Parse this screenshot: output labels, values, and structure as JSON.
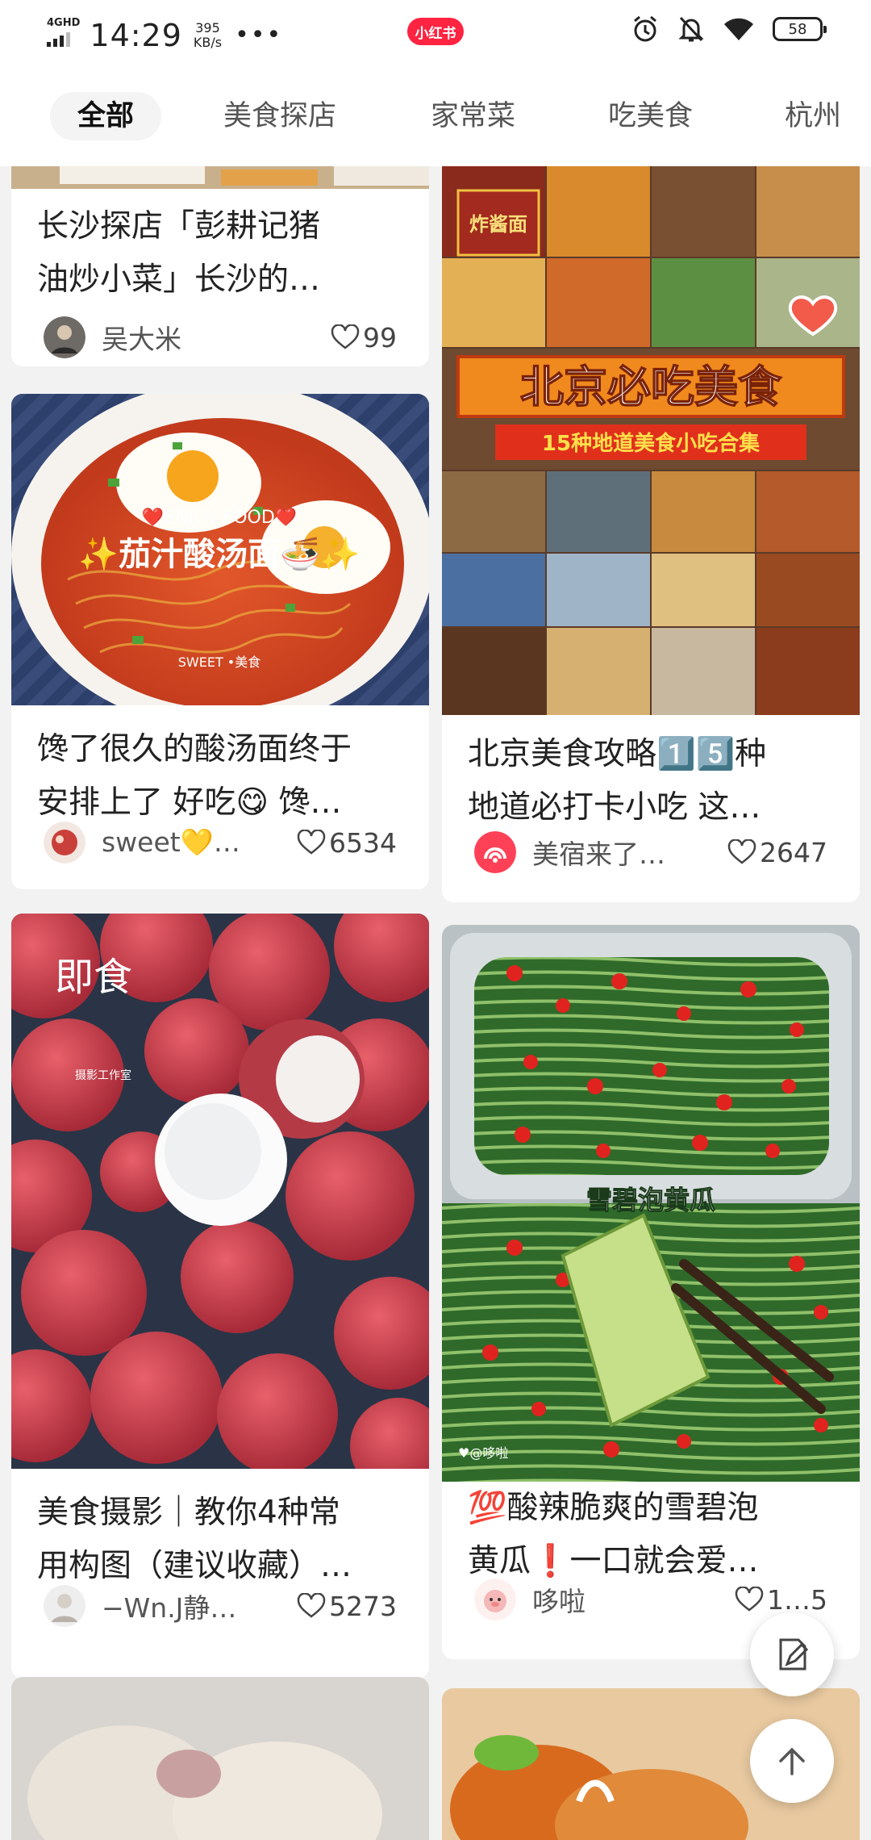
{
  "status_bar": {
    "network": "4GHD",
    "time": "14:29",
    "speed_value": "395",
    "speed_unit": "KB/s",
    "more": "•••",
    "brand": "小红书",
    "battery": "58"
  },
  "tabs": [
    {
      "label": "全部",
      "active": true
    },
    {
      "label": "美食探店"
    },
    {
      "label": "家常菜"
    },
    {
      "label": "吃美食"
    },
    {
      "label": "杭州"
    }
  ],
  "feed": {
    "left": [
      {
        "title_1": "长沙探店「彭耕记猪",
        "title_2": "油炒小菜」长沙的…",
        "author": "吴大米",
        "likes": "99"
      },
      {
        "title_1": "馋了很久的酸汤面终于",
        "title_2": "安排上了 好吃😋 馋…",
        "author": "sweet💛…",
        "likes": "6534",
        "image_text": {
          "top": "❤️ENJOY FOOD❤️",
          "main": "✨茄汁酸汤面🍜✨",
          "bottom": "SWEET •美食"
        }
      },
      {
        "title_1": "美食摄影｜教你4种常",
        "title_2": "用构图（建议收藏）…",
        "author": "−Wn.J静…",
        "likes": "5273",
        "image_text": {
          "big": "即食",
          "small": "摄影工作室"
        }
      }
    ],
    "right": [
      {
        "title_1": "北京美食攻略1️⃣5️⃣种",
        "title_2": "地道必打卡小吃 这…",
        "author": "美宿来了…",
        "likes": "2647",
        "image_text": {
          "banner": "北京必吃美食",
          "sub": "15种地道美食小吃合集",
          "sign": "炸酱面"
        }
      },
      {
        "title_1": "💯酸辣脆爽的雪碧泡",
        "title_2": "黄瓜❗一口就会爱…",
        "author": "哆啦",
        "likes": "1…5",
        "image_text": {
          "label": "雪碧泡黄瓜",
          "watermark": "♥@哆啦"
        }
      }
    ]
  },
  "colors": {
    "brand_red": "#ff2442",
    "background": "#f2f2f2",
    "card": "#ffffff"
  },
  "icons": [
    "heart-icon",
    "alarm-icon",
    "mute-bell-icon",
    "wifi-icon",
    "edit-note-icon",
    "arrow-up-icon"
  ]
}
